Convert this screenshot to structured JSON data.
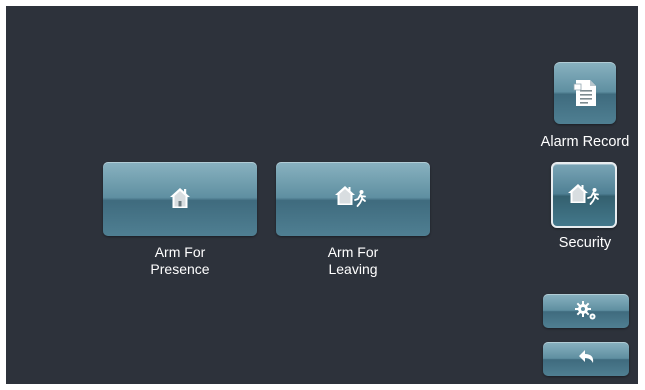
{
  "main": {
    "arm_presence": {
      "label": "Arm For\nPresence",
      "icon": "house-icon"
    },
    "arm_leaving": {
      "label": "Arm For\nLeaving",
      "icon": "house-running-person-icon"
    }
  },
  "sidebar": {
    "alarm_record": {
      "label": "Alarm Record",
      "icon": "document-icon"
    },
    "security": {
      "label": "Security",
      "icon": "house-running-person-icon",
      "selected": true
    },
    "settings": {
      "icon": "gears-icon"
    },
    "back": {
      "icon": "back-arrow-icon"
    }
  },
  "colors": {
    "background": "#2d323b",
    "button_top": "#89b2c0",
    "button_bottom": "#3f6b7e",
    "text": "#ffffff"
  }
}
